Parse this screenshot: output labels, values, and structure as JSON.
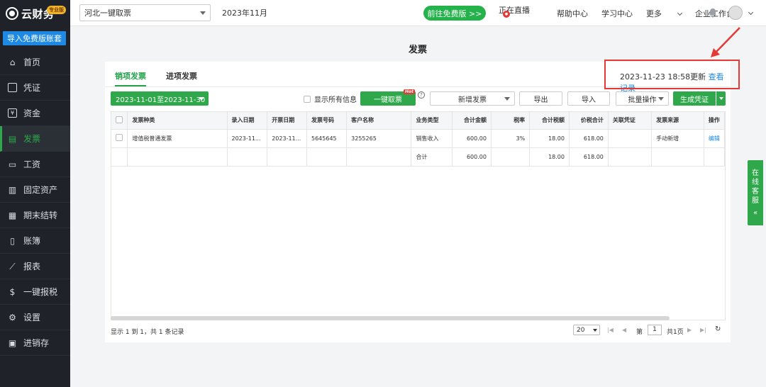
{
  "sidebar": {
    "logo_text": "云财务",
    "edition_badge": "专业版",
    "import_button": "导入免费版账套",
    "items": [
      {
        "label": "首页",
        "icon": "home-icon"
      },
      {
        "label": "凭证",
        "icon": "voucher-icon"
      },
      {
        "label": "资金",
        "icon": "fund-icon"
      },
      {
        "label": "发票",
        "icon": "invoice-icon",
        "active": true
      },
      {
        "label": "工资",
        "icon": "salary-icon"
      },
      {
        "label": "固定资产",
        "icon": "asset-icon"
      },
      {
        "label": "期末结转",
        "icon": "calendar-icon"
      },
      {
        "label": "账簿",
        "icon": "book-icon"
      },
      {
        "label": "报表",
        "icon": "chart-icon"
      },
      {
        "label": "一键报税",
        "icon": "tax-icon"
      },
      {
        "label": "设置",
        "icon": "gear-icon"
      },
      {
        "label": "进销存",
        "icon": "inventory-icon"
      }
    ]
  },
  "topbar": {
    "company": "河北一键取票",
    "period": "2023年11月",
    "free_button": "前往免费版 >>",
    "links": [
      "正在直播",
      "帮助中心",
      "学习中心",
      "更多",
      "企业工作台"
    ]
  },
  "page": {
    "title": "发票",
    "tabs": [
      "销项发票",
      "进项发票"
    ],
    "update_time": "2023-11-23 18:58更新",
    "view_records": "查看记录"
  },
  "toolbar": {
    "date_range": "2023-11-01至2023-11-30",
    "show_all": "显示所有信息",
    "one_key": "一键取票",
    "hot": "Hot",
    "add_invoice": "新增发票",
    "export": "导出",
    "import": "导入",
    "batch": "批量操作",
    "generate": "生成凭证"
  },
  "table": {
    "headers": [
      "发票种类",
      "录入日期",
      "开票日期",
      "发票号码",
      "客户名称",
      "业务类型",
      "合计金额",
      "税率",
      "合计税额",
      "价税合计",
      "关联凭证",
      "发票来源",
      "操作"
    ],
    "rows": [
      [
        "增值税普通发票",
        "2023-11...",
        "2023-11...",
        "5645645",
        "3255265",
        "销售收入",
        "600.00",
        "3%",
        "18.00",
        "618.00",
        "",
        "手动新增",
        "编辑"
      ]
    ],
    "total": {
      "label": "合计",
      "amount": "600.00",
      "tax": "18.00",
      "sum": "618.00"
    }
  },
  "pager": {
    "summary": "显示 1 到 1，共 1 条记录",
    "page_size": "20",
    "page_label": "第",
    "page_num": "1",
    "page_total": "共1页"
  },
  "service": [
    "在",
    "线",
    "客",
    "服",
    "«"
  ]
}
